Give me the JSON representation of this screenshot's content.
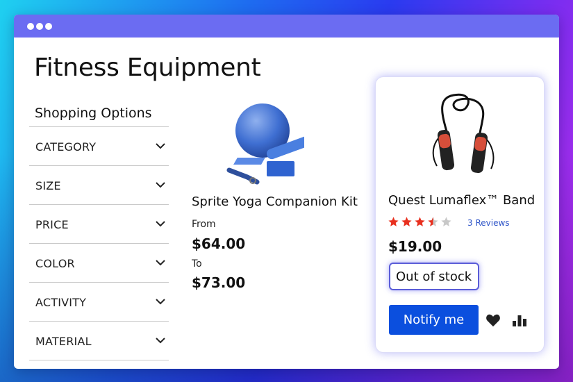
{
  "page": {
    "title": "Fitness Equipment"
  },
  "sidebar": {
    "heading": "Shopping Options",
    "filters": [
      {
        "label": "CATEGORY"
      },
      {
        "label": "SIZE"
      },
      {
        "label": "PRICE"
      },
      {
        "label": "COLOR"
      },
      {
        "label": "ACTIVITY"
      },
      {
        "label": "MATERIAL"
      }
    ]
  },
  "products": [
    {
      "name": "Sprite Yoga Companion Kit",
      "image_icon": "yoga-kit-image",
      "from_label": "From",
      "from_price": "$64.00",
      "to_label": "To",
      "to_price": "$73.00"
    },
    {
      "name": "Quest Lumaflex™ Band",
      "image_icon": "jump-rope-image",
      "rating": 3.5,
      "rating_max": 5,
      "reviews_label": "3 Reviews",
      "price": "$19.00",
      "stock_status": "Out of stock",
      "notify_label": "Notify me"
    }
  ],
  "colors": {
    "titlebar": "#6b6cf2",
    "primary_button": "#0b4fde",
    "star_filled": "#e8301f",
    "star_empty": "#c8c8c8",
    "link": "#2f55c8"
  }
}
